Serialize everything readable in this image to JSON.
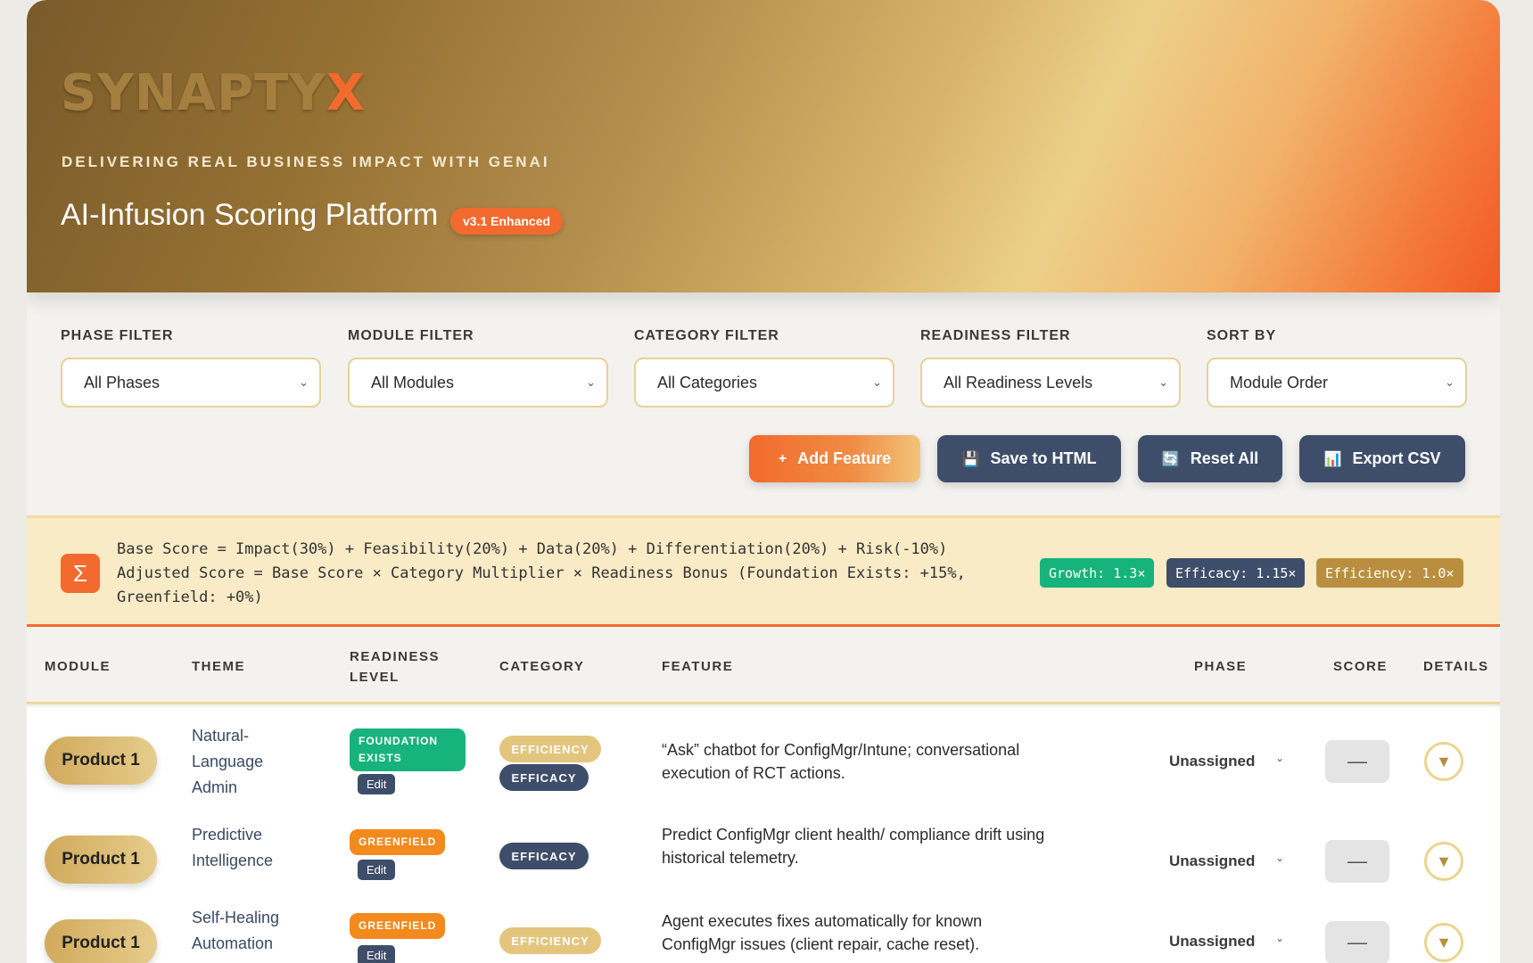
{
  "header": {
    "logo_main": "SYNAPTY",
    "logo_accent": "X",
    "tagline": "DELIVERING REAL BUSINESS IMPACT WITH GENAI",
    "title": "AI-Infusion Scoring Platform",
    "version_badge": "v3.1 Enhanced"
  },
  "filters": [
    {
      "label": "PHASE FILTER",
      "value": "All Phases"
    },
    {
      "label": "MODULE FILTER",
      "value": "All Modules"
    },
    {
      "label": "CATEGORY FILTER",
      "value": "All Categories"
    },
    {
      "label": "READINESS FILTER",
      "value": "All Readiness Levels"
    },
    {
      "label": "SORT BY",
      "value": "Module Order"
    }
  ],
  "actions": {
    "add": "Add Feature",
    "save": "Save to HTML",
    "reset": "Reset All",
    "export": "Export CSV"
  },
  "formula": {
    "line1": "Base Score = Impact(30%) + Feasibility(20%) + Data(20%) + Differentiation(20%) + Risk(-10%)",
    "line2": "Adjusted Score = Base Score × Category Multiplier × Readiness Bonus (Foundation Exists: +15%,",
    "line3": "Greenfield: +0%)",
    "multipliers": {
      "growth": "Growth: 1.3×",
      "efficacy": "Efficacy: 1.15×",
      "efficiency": "Efficiency: 1.0×"
    }
  },
  "table": {
    "headers": {
      "module": "MODULE",
      "theme": "THEME",
      "readiness_1": "READINESS",
      "readiness_2": "LEVEL",
      "category": "CATEGORY",
      "feature": "FEATURE",
      "phase": "PHASE",
      "score": "SCORE",
      "details": "DETAILS"
    },
    "rows": [
      {
        "module": "Product 1",
        "theme_lines": [
          "Natural-",
          "Language",
          "Admin"
        ],
        "readiness_lines": [
          "FOUNDATION",
          "EXISTS"
        ],
        "edit": "Edit",
        "categories": [
          "EFFICIENCY",
          "EFFICACY"
        ],
        "feature_lines": [
          "“Ask” chatbot for ConfigMgr/Intune; conversational",
          "execution of RCT actions."
        ],
        "phase": "Unassigned",
        "score": "—"
      },
      {
        "module": "Product 1",
        "theme_lines": [
          "Predictive",
          "Intelligence"
        ],
        "readiness_lines": [
          "GREENFIELD"
        ],
        "edit": "Edit",
        "categories": [
          "EFFICACY"
        ],
        "feature_lines": [
          "Predict ConfigMgr client health/ compliance drift using",
          "historical telemetry."
        ],
        "phase": "Unassigned",
        "score": "—"
      },
      {
        "module": "Product 1",
        "theme_lines": [
          "Self-Healing",
          "Automation"
        ],
        "readiness_lines": [
          "GREENFIELD"
        ],
        "edit": "Edit",
        "categories": [
          "EFFICIENCY"
        ],
        "feature_lines": [
          "Agent executes fixes automatically for known",
          "ConfigMgr issues (client repair, cache reset)."
        ],
        "phase": "Unassigned",
        "score": "—"
      }
    ]
  },
  "icons": {
    "sigma": "Σ",
    "plus": "+",
    "save": "💾",
    "reset": "🔄",
    "export": "📊",
    "details": "▼",
    "chevron": "⌄"
  }
}
